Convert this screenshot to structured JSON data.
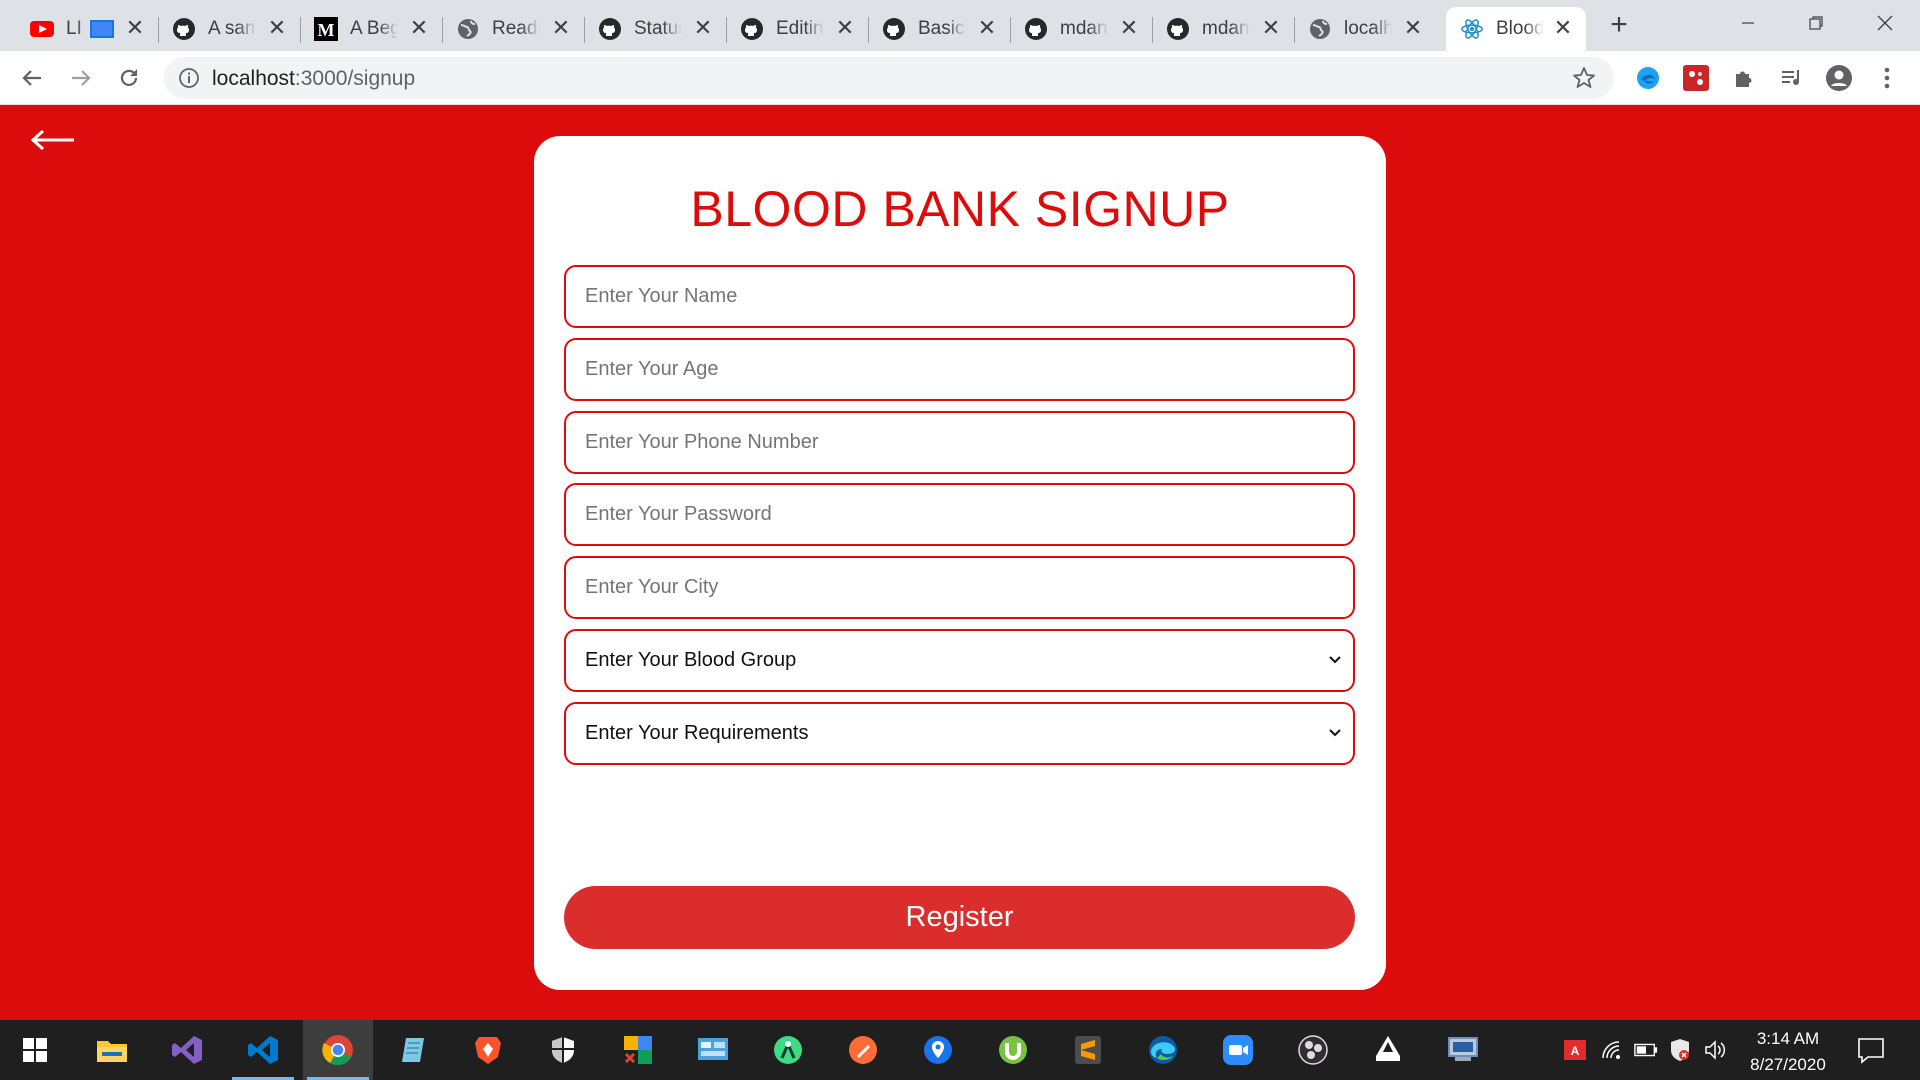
{
  "browser": {
    "tabs": [
      {
        "title": "LI",
        "icon": "youtube-icon"
      },
      {
        "title": "A sam",
        "icon": "github-icon"
      },
      {
        "title": "A Beg",
        "icon": "medium-icon"
      },
      {
        "title": "Readi",
        "icon": "globe-icon"
      },
      {
        "title": "Status",
        "icon": "github-icon"
      },
      {
        "title": "Editin",
        "icon": "github-icon"
      },
      {
        "title": "Basic",
        "icon": "github-icon"
      },
      {
        "title": "mdan",
        "icon": "github-icon"
      },
      {
        "title": "mdan",
        "icon": "github-icon"
      },
      {
        "title": "localh",
        "icon": "globe-icon"
      },
      {
        "title": "Blood",
        "icon": "react-icon",
        "active": true
      }
    ],
    "close_glyph": "✕",
    "new_tab_glyph": "+",
    "url_host": "localhost",
    "url_path": ":3000/signup"
  },
  "page": {
    "title": "BLOOD BANK SIGNUP",
    "fields": {
      "name_placeholder": "Enter Your Name",
      "age_placeholder": "Enter Your Age",
      "phone_placeholder": "Enter Your Phone Number",
      "password_placeholder": "Enter Your Password",
      "city_placeholder": "Enter Your City"
    },
    "selects": {
      "blood_group": "Enter Your Blood Group",
      "requirements": "Enter Your Requirements"
    },
    "register_label": "Register",
    "colors": {
      "background": "#dd0c0c",
      "button": "#dc2d2d",
      "card": "#ffffff"
    }
  },
  "taskbar": {
    "time": "3:14 AM",
    "date": "8/27/2020"
  }
}
